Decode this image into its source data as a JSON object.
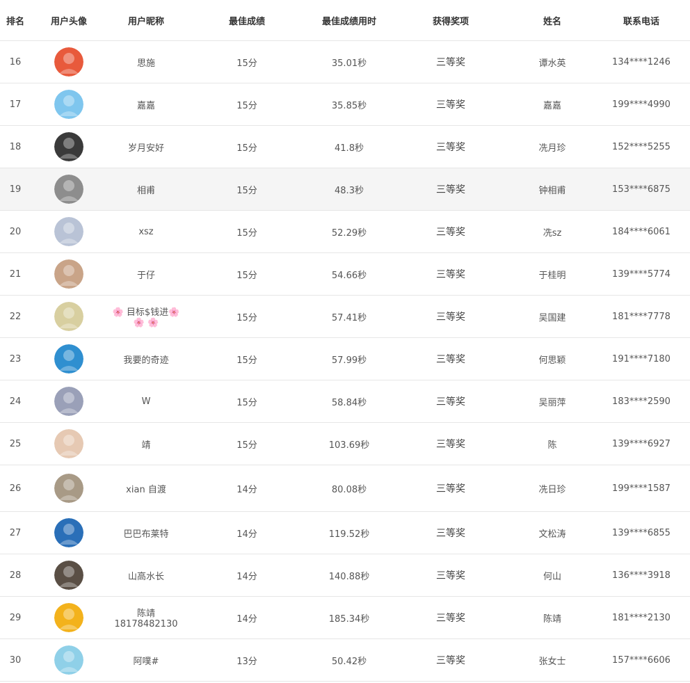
{
  "headers": {
    "rank": "排名",
    "avatar": "用户头像",
    "nickname": "用户昵称",
    "best_score": "最佳成绩",
    "best_time": "最佳成绩用时",
    "prize": "获得奖项",
    "name": "姓名",
    "phone": "联系电话"
  },
  "rows": [
    {
      "rank": "16",
      "nickname": "思施",
      "score": "15分",
      "time": "35.01秒",
      "prize": "三等奖",
      "name": "谭水英",
      "phone": "134****1246",
      "avatar_icon": "cartoon-figures-avatar",
      "avatar_color": "#e85a3c"
    },
    {
      "rank": "17",
      "nickname": "嘉嘉",
      "score": "15分",
      "time": "35.85秒",
      "prize": "三等奖",
      "name": "嘉嘉",
      "phone": "199****4990",
      "avatar_icon": "doraemon-avatar",
      "avatar_color": "#7fc6ee"
    },
    {
      "rank": "18",
      "nickname": "岁月安好",
      "score": "15分",
      "time": "41.8秒",
      "prize": "三等奖",
      "name": "冼月珍",
      "phone": "152****5255",
      "avatar_icon": "sunglasses-photo-avatar",
      "avatar_color": "#3a3a3a"
    },
    {
      "rank": "19",
      "nickname": "相甫",
      "score": "15分",
      "time": "48.3秒",
      "prize": "三等奖",
      "name": "钟相甫",
      "phone": "153****6875",
      "avatar_icon": "stairs-photo-avatar",
      "avatar_color": "#8d8d8d"
    },
    {
      "rank": "20",
      "nickname": "xsz",
      "score": "15分",
      "time": "52.29秒",
      "prize": "三等奖",
      "name": "冼sz",
      "phone": "184****6061",
      "avatar_icon": "sky-photo-avatar",
      "avatar_color": "#b9c3d6"
    },
    {
      "rank": "21",
      "nickname": "于仔",
      "score": "15分",
      "time": "54.66秒",
      "prize": "三等奖",
      "name": "于桂明",
      "phone": "139****5774",
      "avatar_icon": "child-photo-avatar",
      "avatar_color": "#c9a488"
    },
    {
      "rank": "22",
      "nickname": "🌸 目标$钱进🌸 🌸 🌸",
      "score": "15分",
      "time": "57.41秒",
      "prize": "三等奖",
      "name": "吴国建",
      "phone": "181****7778",
      "avatar_icon": "food-photo-avatar",
      "avatar_color": "#d8cfa0"
    },
    {
      "rank": "23",
      "nickname": "我要的奇迹",
      "score": "15分",
      "time": "57.99秒",
      "prize": "三等奖",
      "name": "何思颖",
      "phone": "191****7180",
      "avatar_icon": "pool-photo-avatar",
      "avatar_color": "#2f8fd0"
    },
    {
      "rank": "24",
      "nickname": "W",
      "score": "15分",
      "time": "58.84秒",
      "prize": "三等奖",
      "name": "吴丽萍",
      "phone": "183****2590",
      "avatar_icon": "portrait-photo-avatar",
      "avatar_color": "#9aa0b8"
    },
    {
      "rank": "25",
      "nickname": "靖",
      "score": "15分",
      "time": "103.69秒",
      "prize": "三等奖",
      "name": "陈",
      "phone": "139****6927",
      "avatar_icon": "face-photo-avatar",
      "avatar_color": "#e6c9b3"
    },
    {
      "rank": "26",
      "nickname": "xian 自渡",
      "score": "14分",
      "time": "80.08秒",
      "prize": "三等奖",
      "name": "冼日珍",
      "phone": "199****1587",
      "avatar_icon": "group-photo-avatar",
      "avatar_color": "#a89a86"
    },
    {
      "rank": "27",
      "nickname": "巴巴布莱特",
      "score": "14分",
      "time": "119.52秒",
      "prize": "三等奖",
      "name": "文松涛",
      "phone": "139****6855",
      "avatar_icon": "clouds-photo-avatar",
      "avatar_color": "#2a6fb8"
    },
    {
      "rank": "28",
      "nickname": "山高水长",
      "score": "14分",
      "time": "140.88秒",
      "prize": "三等奖",
      "name": "何山",
      "phone": "136****3918",
      "avatar_icon": "room-photo-avatar",
      "avatar_color": "#5a4f45"
    },
    {
      "rank": "29",
      "nickname": "陈靖18178482130",
      "score": "14分",
      "time": "185.34秒",
      "prize": "三等奖",
      "name": "陈靖",
      "phone": "181****2130",
      "avatar_icon": "sun-sketch-avatar",
      "avatar_color": "#f3b21c"
    },
    {
      "rank": "30",
      "nickname": "阿噗#",
      "score": "13分",
      "time": "50.42秒",
      "prize": "三等奖",
      "name": "张女士",
      "phone": "157****6606",
      "avatar_icon": "crayon-shin-chan-avatar",
      "avatar_color": "#8fd0e8"
    }
  ]
}
